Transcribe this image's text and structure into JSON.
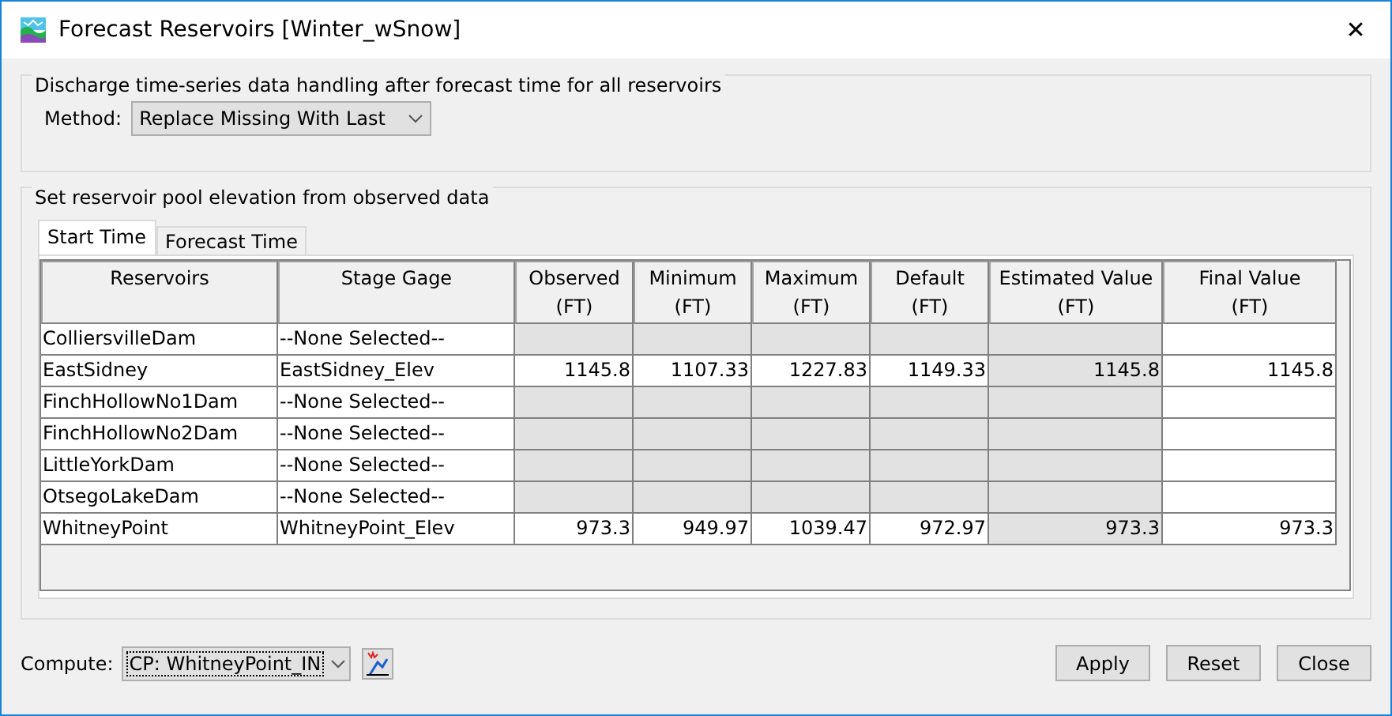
{
  "window": {
    "title": "Forecast Reservoirs [Winter_wSnow]",
    "close": "✕"
  },
  "discharge_group": {
    "title": "Discharge time-series data handling after forecast time for all reservoirs",
    "method_label": "Method:",
    "method_value": "Replace Missing With Last"
  },
  "pool_group": {
    "title": "Set reservoir pool elevation from observed data",
    "tabs": [
      {
        "label": "Start Time",
        "selected": true
      },
      {
        "label": "Forecast Time",
        "selected": false
      }
    ],
    "table": {
      "columns": [
        {
          "name": "Reservoirs"
        },
        {
          "name": "Stage Gage"
        },
        {
          "name": "Observed",
          "unit": "(FT)"
        },
        {
          "name": "Minimum",
          "unit": "(FT)"
        },
        {
          "name": "Maximum",
          "unit": "(FT)"
        },
        {
          "name": "Default",
          "unit": "(FT)"
        },
        {
          "name": "Estimated Value",
          "unit": "(FT)"
        },
        {
          "name": "Final Value",
          "unit": "(FT)"
        }
      ],
      "rows": [
        {
          "cells": [
            {
              "text": "ColliersvilleDam",
              "editable": true
            },
            {
              "text": "--None Selected--",
              "editable": true
            },
            {
              "editable": false
            },
            {
              "editable": false
            },
            {
              "editable": false
            },
            {
              "editable": false
            },
            {
              "editable": false
            },
            {
              "editable": true
            }
          ]
        },
        {
          "cells": [
            {
              "text": "EastSidney",
              "editable": true
            },
            {
              "text": "EastSidney_Elev",
              "editable": true
            },
            {
              "text": "1145.8",
              "editable": true
            },
            {
              "text": "1107.33",
              "editable": true
            },
            {
              "text": "1227.83",
              "editable": true
            },
            {
              "text": "1149.33",
              "editable": true
            },
            {
              "text": "1145.8",
              "editable": false
            },
            {
              "text": "1145.8",
              "editable": true
            }
          ]
        },
        {
          "cells": [
            {
              "text": "FinchHollowNo1Dam",
              "editable": true
            },
            {
              "text": "--None Selected--",
              "editable": true
            },
            {
              "editable": false
            },
            {
              "editable": false
            },
            {
              "editable": false
            },
            {
              "editable": false
            },
            {
              "editable": false
            },
            {
              "editable": true
            }
          ]
        },
        {
          "cells": [
            {
              "text": "FinchHollowNo2Dam",
              "editable": true
            },
            {
              "text": "--None Selected--",
              "editable": true
            },
            {
              "editable": false
            },
            {
              "editable": false
            },
            {
              "editable": false
            },
            {
              "editable": false
            },
            {
              "editable": false
            },
            {
              "editable": true
            }
          ]
        },
        {
          "cells": [
            {
              "text": "LittleYorkDam",
              "editable": true
            },
            {
              "text": "--None Selected--",
              "editable": true
            },
            {
              "editable": false
            },
            {
              "editable": false
            },
            {
              "editable": false
            },
            {
              "editable": false
            },
            {
              "editable": false
            },
            {
              "editable": true
            }
          ]
        },
        {
          "cells": [
            {
              "text": "OtsegoLakeDam",
              "editable": true
            },
            {
              "text": "--None Selected--",
              "editable": true
            },
            {
              "editable": false
            },
            {
              "editable": false
            },
            {
              "editable": false
            },
            {
              "editable": false
            },
            {
              "editable": false
            },
            {
              "editable": true
            }
          ]
        },
        {
          "cells": [
            {
              "text": "WhitneyPoint",
              "editable": true
            },
            {
              "text": "WhitneyPoint_Elev",
              "editable": true
            },
            {
              "text": "973.3",
              "editable": true
            },
            {
              "text": "949.97",
              "editable": true
            },
            {
              "text": "1039.47",
              "editable": true
            },
            {
              "text": "972.97",
              "editable": true
            },
            {
              "text": "973.3",
              "editable": false
            },
            {
              "text": "973.3",
              "editable": true
            }
          ]
        }
      ]
    }
  },
  "footer": {
    "compute_label": "Compute:",
    "compute_value": "CP: WhitneyPoint_IN",
    "buttons": [
      "Apply",
      "Reset",
      "Close"
    ]
  }
}
